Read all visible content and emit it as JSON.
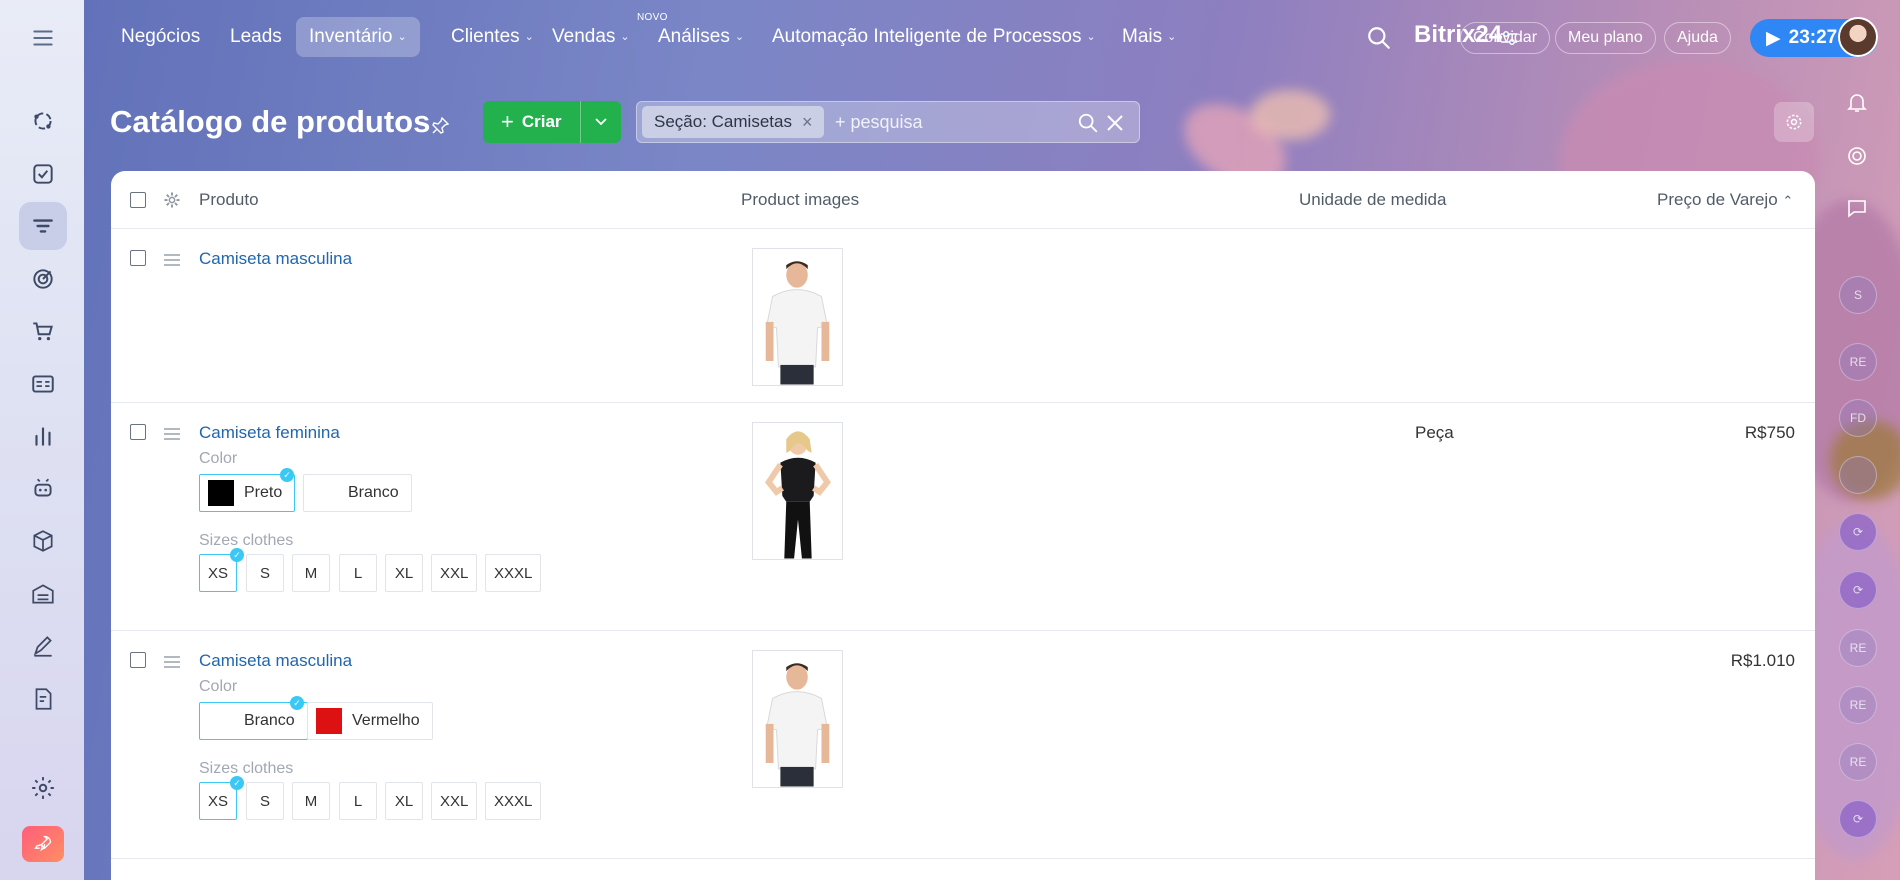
{
  "nav": {
    "menu_icon": "hamburger-icon",
    "items": [
      {
        "label": "Negócios",
        "chevron": false
      },
      {
        "label": "Leads",
        "chevron": false
      },
      {
        "label": "Inventário",
        "chevron": true,
        "active": true
      },
      {
        "label": "Clientes",
        "chevron": true
      },
      {
        "label": "Vendas",
        "chevron": true,
        "badge": "NOVO"
      },
      {
        "label": "Análises",
        "chevron": true
      },
      {
        "label": "Automação Inteligente de Processos",
        "chevron": true
      },
      {
        "label": "Mais",
        "chevron": true
      }
    ],
    "brand": "Bitrix24",
    "invite_label": "Convidar",
    "plan_label": "Meu plano",
    "help_label": "Ajuda",
    "timer": "23:27"
  },
  "page": {
    "title": "Catálogo de produtos",
    "create_label": "Criar",
    "filter_chip": "Seção: Camisetas",
    "filter_placeholder": "+ pesquisa"
  },
  "table": {
    "columns": {
      "product": "Produto",
      "images": "Product images",
      "unit": "Unidade de medida",
      "price": "Preço de Varejo"
    },
    "rows": [
      {
        "name": "Camiseta masculina",
        "unit": "",
        "price": "",
        "image": "man-white-tshirt"
      },
      {
        "name": "Camiseta feminina",
        "unit": "Peça",
        "price": "R$750",
        "image": "woman-black-tshirt",
        "color_label": "Color",
        "colors": [
          {
            "label": "Preto",
            "swatch": "#000000",
            "selected": true
          },
          {
            "label": "Branco",
            "swatch": "#ffffff",
            "selected": false
          }
        ],
        "size_label": "Sizes clothes",
        "sizes": [
          "XS",
          "S",
          "M",
          "L",
          "XL",
          "XXL",
          "XXXL"
        ],
        "selected_size": "XS"
      },
      {
        "name": "Camiseta masculina",
        "unit": "",
        "price": "R$1.010",
        "image": "man-white-tshirt",
        "color_label": "Color",
        "colors": [
          {
            "label": "Branco",
            "swatch": "#ffffff",
            "selected": true
          },
          {
            "label": "Vermelho",
            "swatch": "#dd1111",
            "selected": false
          }
        ],
        "size_label": "Sizes clothes",
        "sizes": [
          "XS",
          "S",
          "M",
          "L",
          "XL",
          "XXL",
          "XXXL"
        ],
        "selected_size": "XS"
      }
    ]
  },
  "right_rail": {
    "avatars": [
      "S",
      "RE",
      "FD",
      "",
      "",
      "",
      "RE",
      "RE",
      "RE",
      ""
    ]
  },
  "colors": {
    "create_green": "#22b14c",
    "link_blue": "#2066b0",
    "select_cyan": "#3bc8f5",
    "timer_blue": "#2f87f5"
  }
}
